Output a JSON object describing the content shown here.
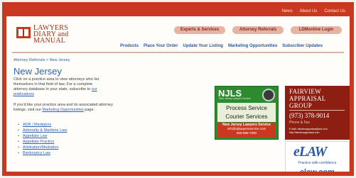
{
  "topbar": {
    "links": [
      "News",
      "About Us",
      "Contact Us"
    ]
  },
  "logo": {
    "line1": "LAWYERS",
    "line2": "DIARY and",
    "line3": "MANUAL"
  },
  "header_buttons": [
    "Experts & Services",
    "Attorney Referrals",
    "LDMonline Login"
  ],
  "nav": [
    "Products",
    "Place Your Order",
    "Update Your Listing",
    "Marketing Opportunities",
    "Subscriber Updates"
  ],
  "breadcrumb": "Attorney Referrals > New Jersey",
  "page": {
    "title": "New Jersey",
    "intro_line1": "Click on a practice area to view attorneys who list",
    "intro_line2": "themselves in that field of law. For a complete",
    "intro_line3_text": "attorney database in your state, subscribe to ",
    "intro_link1": "our",
    "intro_link2": "publications",
    "intro_line4": "If you'd like your practice area and its associated attorney",
    "intro_line5_text": "listings, visit our ",
    "intro_link3": "Marketing Opportunities",
    "intro_line5_tail": " page."
  },
  "practice_areas": [
    "ADR / Mediators",
    "Admiralty & Maritime Law",
    "Appellate Law",
    "Appellate Practice",
    "Arbitration/Mediation",
    "Bankruptcy Law"
  ],
  "ads": {
    "njls": {
      "brand": "NJLS",
      "tagline": "New Jersey Lawyers Service",
      "service_line1": "Process Service",
      "service_line2": "Courier Services",
      "footer_title": "New Jersey Lawyers Service",
      "footer_email": "info@njlawyersservice.com",
      "footer_phone": "800-888-7000"
    },
    "fairview": {
      "line1": "FAIRVIEW",
      "line2": "APPRAISAL",
      "line3": "GROUP",
      "phone": "(973) 378-9014",
      "location": "Phone & Fax",
      "contact_line1": "E-Mail: fairviewappraisal@aol.com",
      "contact_line2": "http://fairviewappraisal.com"
    },
    "elaw": {
      "logo": "eLAW",
      "tagline": "Practice with confidence",
      "url": "elaw.com"
    }
  },
  "colors": {
    "brand_red": "#c8391f",
    "link_blue": "#2f63b2",
    "njls_green": "#2d8a2d",
    "fairview_maroon": "#8c1e12"
  }
}
